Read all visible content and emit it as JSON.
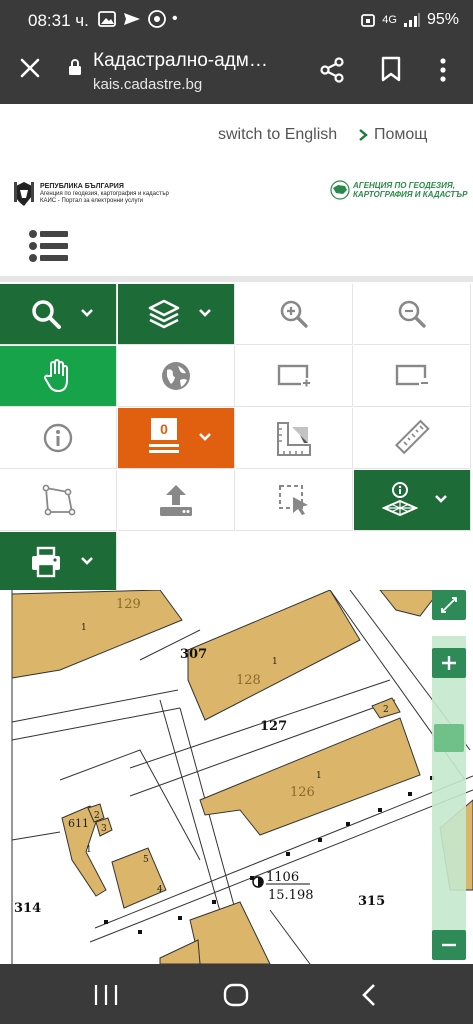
{
  "status": {
    "time": "08:31 ч.",
    "signal": "4G",
    "battery": "95%"
  },
  "browser": {
    "title": "Кадастрално-адм…",
    "url": "kais.cadastre.bg"
  },
  "header": {
    "lang_link": "switch to English",
    "help_link": "Помощ",
    "logo_left": {
      "line1": "РЕПУБЛИКА БЪЛГАРИЯ",
      "line2": "Агенция по геодезия, картография и кадастър",
      "line3": "КАИС - Портал за електронни услуги"
    },
    "logo_right": {
      "line1": "АГЕНЦИЯ ПО ГЕОДЕЗИЯ,",
      "line2": "КАРТОГРАФИЯ И КАДАСТЪР"
    }
  },
  "toolbar": {
    "layer_count": "0"
  },
  "map": {
    "parcels": [
      {
        "number": "129",
        "sub": "1"
      },
      {
        "number": "128",
        "sub": "1"
      },
      {
        "number": "126",
        "sub": "1"
      },
      {
        "number": "611",
        "sub": "1"
      }
    ],
    "labels": {
      "p307": "307",
      "p127": "127",
      "p314": "314",
      "p315": "315",
      "b2": "2",
      "b3": "3",
      "b2b": "2",
      "b5": "5",
      "b4": "4",
      "point": "1106",
      "elev": "15.198"
    }
  },
  "colors": {
    "dark_green": "#1d6b36",
    "bright_green": "#16a34a",
    "orange": "#e0600f",
    "parcel_fill": "#dbb56a"
  }
}
